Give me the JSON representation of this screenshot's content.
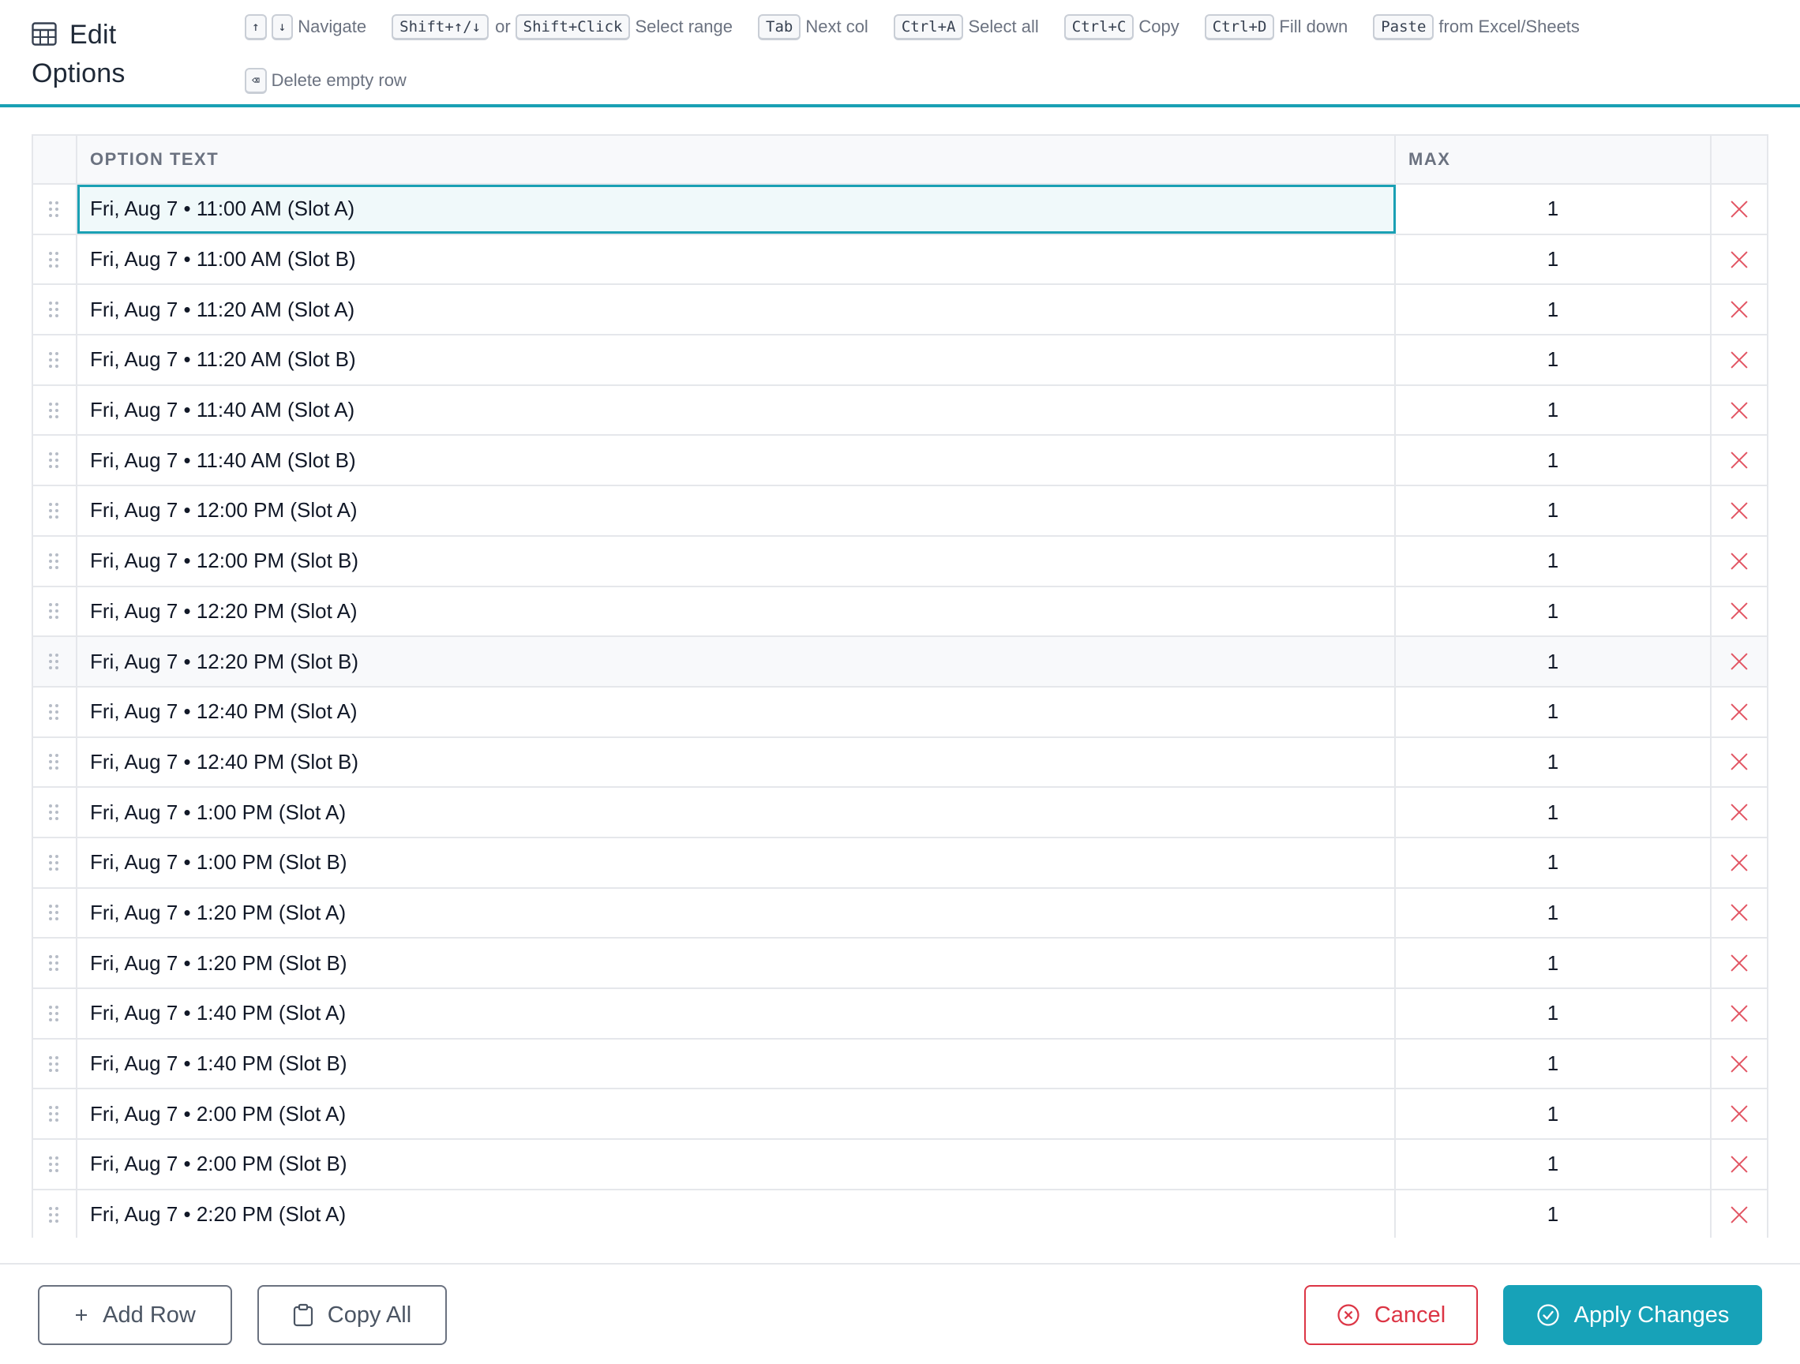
{
  "header": {
    "title_line1": "Edit",
    "title_line2": "Options",
    "icon": "table-icon"
  },
  "shortcuts": [
    {
      "keys": [
        "↑",
        "↓"
      ],
      "label": "Navigate"
    },
    {
      "keys": [
        "Shift+↑/↓"
      ],
      "or": "or",
      "keys2": [
        "Shift+Click"
      ],
      "label": "Select range"
    },
    {
      "keys": [
        "Tab"
      ],
      "label": "Next col"
    },
    {
      "keys": [
        "Ctrl+A"
      ],
      "label": "Select all"
    },
    {
      "keys": [
        "Ctrl+C"
      ],
      "label": "Copy"
    },
    {
      "keys": [
        "Ctrl+D"
      ],
      "label": "Fill down"
    },
    {
      "keys": [
        "Paste"
      ],
      "label": "from Excel/Sheets"
    },
    {
      "keys": [
        "⌫"
      ],
      "label": "Delete empty row"
    }
  ],
  "table": {
    "columns": {
      "option_text": "OPTION TEXT",
      "max": "MAX"
    },
    "rows": [
      {
        "text": "Fri, Aug 7 • 11:00 AM (Slot A)",
        "max": "1"
      },
      {
        "text": "Fri, Aug 7 • 11:00 AM (Slot B)",
        "max": "1"
      },
      {
        "text": "Fri, Aug 7 • 11:20 AM (Slot A)",
        "max": "1"
      },
      {
        "text": "Fri, Aug 7 • 11:20 AM (Slot B)",
        "max": "1"
      },
      {
        "text": "Fri, Aug 7 • 11:40 AM (Slot A)",
        "max": "1"
      },
      {
        "text": "Fri, Aug 7 • 11:40 AM (Slot B)",
        "max": "1"
      },
      {
        "text": "Fri, Aug 7 • 12:00 PM (Slot A)",
        "max": "1"
      },
      {
        "text": "Fri, Aug 7 • 12:00 PM (Slot B)",
        "max": "1"
      },
      {
        "text": "Fri, Aug 7 • 12:20 PM (Slot A)",
        "max": "1"
      },
      {
        "text": "Fri, Aug 7 • 12:20 PM (Slot B)",
        "max": "1"
      },
      {
        "text": "Fri, Aug 7 • 12:40 PM (Slot A)",
        "max": "1"
      },
      {
        "text": "Fri, Aug 7 • 12:40 PM (Slot B)",
        "max": "1"
      },
      {
        "text": "Fri, Aug 7 • 1:00 PM (Slot A)",
        "max": "1"
      },
      {
        "text": "Fri, Aug 7 • 1:00 PM (Slot B)",
        "max": "1"
      },
      {
        "text": "Fri, Aug 7 • 1:20 PM (Slot A)",
        "max": "1"
      },
      {
        "text": "Fri, Aug 7 • 1:20 PM (Slot B)",
        "max": "1"
      },
      {
        "text": "Fri, Aug 7 • 1:40 PM (Slot A)",
        "max": "1"
      },
      {
        "text": "Fri, Aug 7 • 1:40 PM (Slot B)",
        "max": "1"
      },
      {
        "text": "Fri, Aug 7 • 2:00 PM (Slot A)",
        "max": "1"
      },
      {
        "text": "Fri, Aug 7 • 2:00 PM (Slot B)",
        "max": "1"
      },
      {
        "text": "Fri, Aug 7 • 2:20 PM (Slot A)",
        "max": "1"
      }
    ],
    "selected_row": 0,
    "hovered_row": 9
  },
  "footer": {
    "add_row": "Add Row",
    "copy_all": "Copy All",
    "cancel": "Cancel",
    "apply": "Apply Changes"
  },
  "colors": {
    "accent": "#17a2b8",
    "danger": "#dc3545",
    "delete_icon": "#e25563"
  }
}
